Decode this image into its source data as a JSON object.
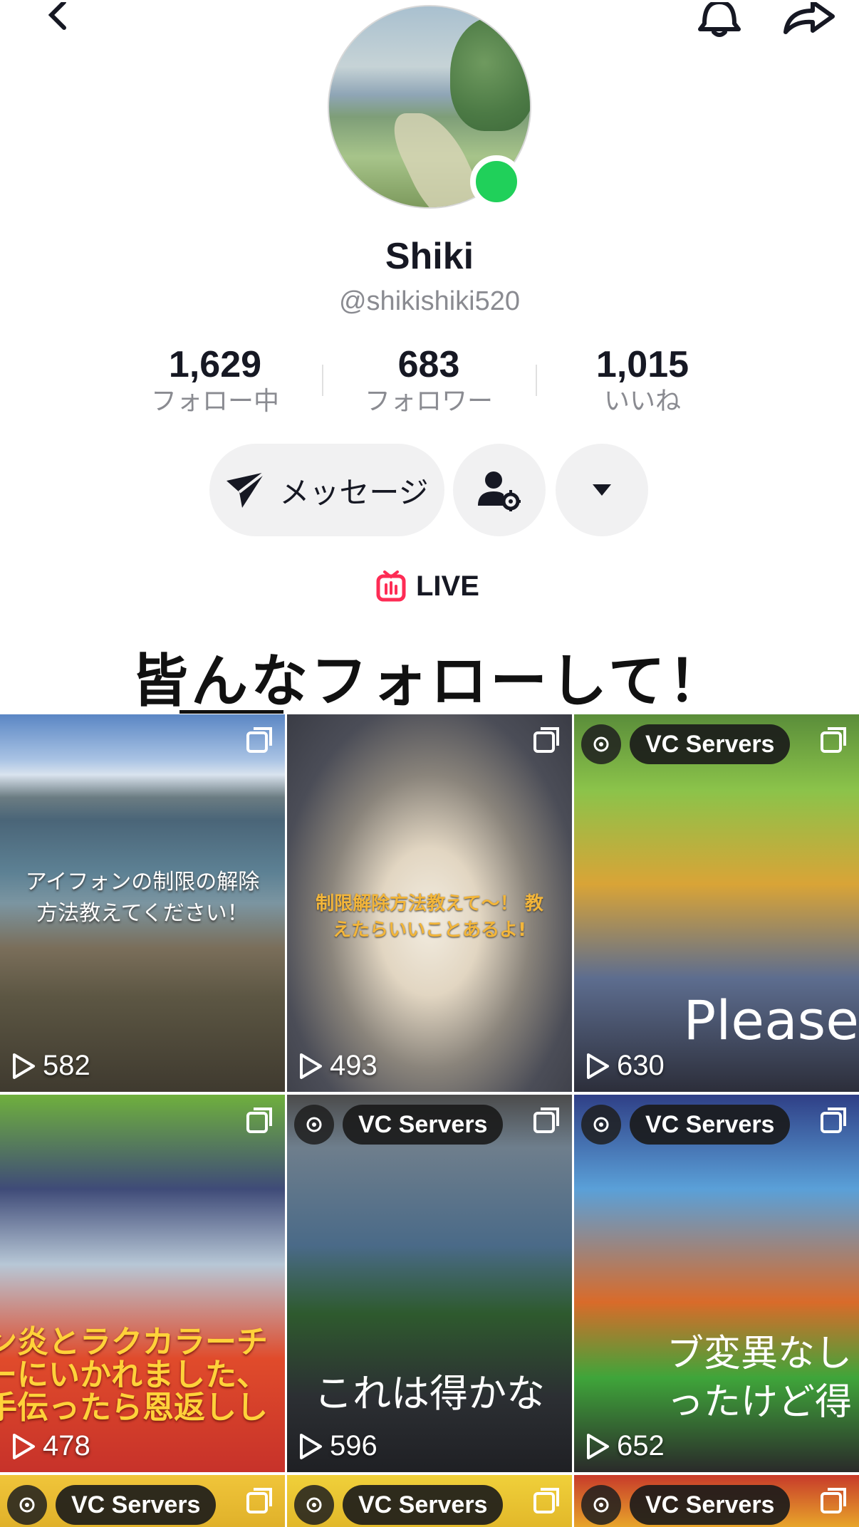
{
  "profile": {
    "display_name": "Shiki",
    "username": "@shikishiki520",
    "online": true
  },
  "stats": {
    "following": {
      "value": "1,629",
      "label": "フォロー中"
    },
    "followers": {
      "value": "683",
      "label": "フォロワー"
    },
    "likes": {
      "value": "1,015",
      "label": "いいね"
    }
  },
  "actions": {
    "message_label": "メッセージ"
  },
  "live": {
    "label": "LIVE",
    "accent": "#fe2c55"
  },
  "bio": "皆んなフォローして！",
  "icons": {
    "back": "chevron-left-icon",
    "bell": "bell-icon",
    "share": "share-arrow-icon",
    "message": "paper-plane-icon",
    "add_friend": "person-gear-icon",
    "dropdown": "triangle-down-icon",
    "live": "tv-icon",
    "views": "play-icon",
    "multi": "multi-image-icon",
    "vc_gear": "gear-icon"
  },
  "colors": {
    "online": "#20d05a",
    "muted_text": "#8a8b91",
    "button_bg": "#f1f1f2"
  },
  "videos": [
    {
      "views": "582",
      "caption": "アイフォンの制限の解除\n方法教えてください！"
    },
    {
      "views": "493",
      "caption": "制限解除方法教えて〜！ 教\nえたらいいことあるよ!"
    },
    {
      "views": "630",
      "badge": "VC Servers",
      "caption": "Please"
    },
    {
      "views": "478",
      "caption": "ン炎とラクカラーチ\nーにいかれました、\n手伝ったら恩返しし"
    },
    {
      "views": "596",
      "badge": "VC Servers",
      "caption": "これは得かな"
    },
    {
      "views": "652",
      "badge": "VC Servers",
      "caption": "ブ変異なし\nったけど得"
    },
    {
      "badge": "VC Servers"
    },
    {
      "badge": "VC Servers"
    },
    {
      "badge": "VC Servers"
    }
  ]
}
